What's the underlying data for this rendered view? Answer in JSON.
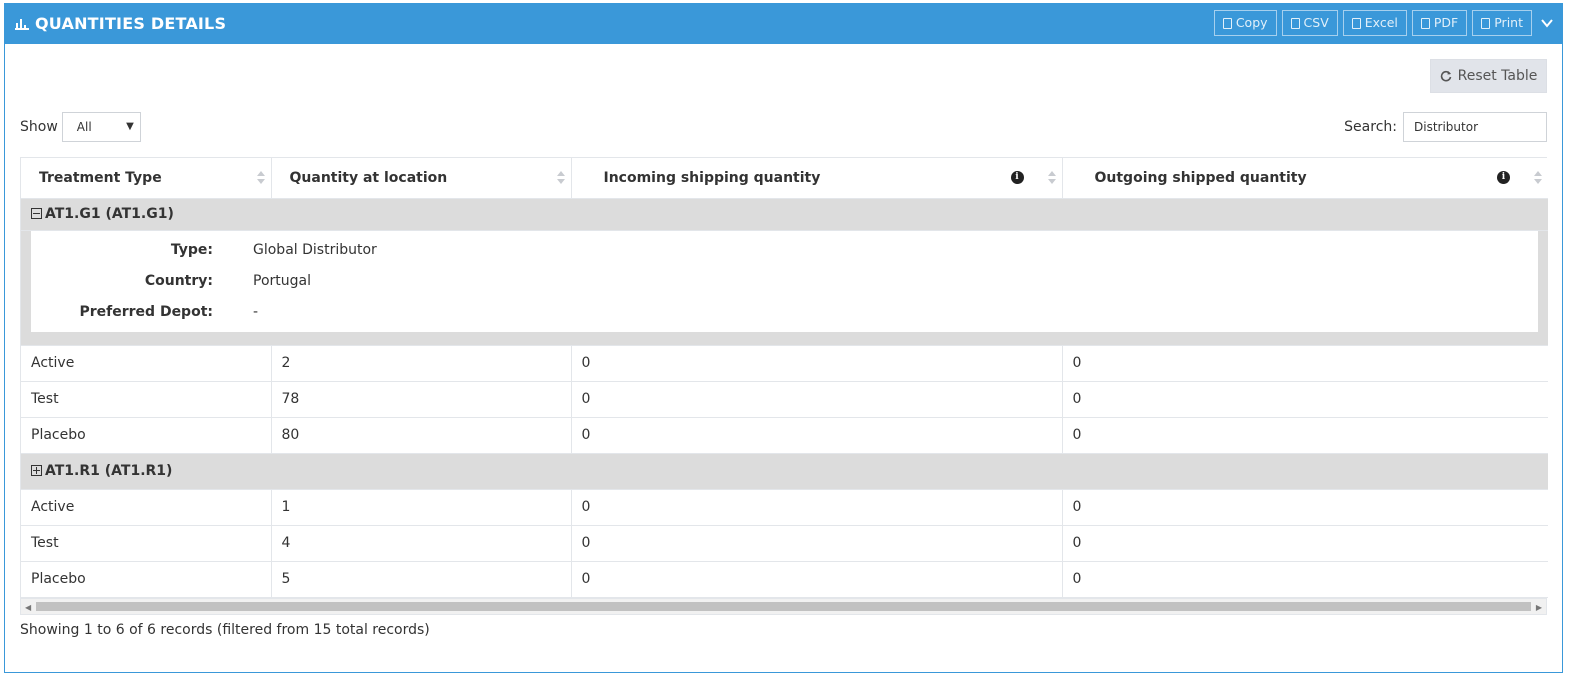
{
  "header": {
    "title": "QUANTITIES DETAILS",
    "buttons": [
      "Copy",
      "CSV",
      "Excel",
      "PDF",
      "Print"
    ]
  },
  "reset_button": "Reset Table",
  "show": {
    "label": "Show",
    "value": "All"
  },
  "search": {
    "label": "Search:",
    "value": "Distributor"
  },
  "columns": [
    "Treatment Type",
    "Quantity at location",
    "Incoming shipping quantity",
    "Outgoing shipped quantity"
  ],
  "groups": [
    {
      "name": "AT1.G1 (AT1.G1)",
      "expanded": true,
      "details": [
        {
          "label": "Type:",
          "value": "Global Distributor"
        },
        {
          "label": "Country:",
          "value": "Portugal"
        },
        {
          "label": "Preferred Depot:",
          "value": "-"
        }
      ],
      "rows": [
        [
          "Active",
          "2",
          "0",
          "0"
        ],
        [
          "Test",
          "78",
          "0",
          "0"
        ],
        [
          "Placebo",
          "80",
          "0",
          "0"
        ]
      ]
    },
    {
      "name": "AT1.R1 (AT1.R1)",
      "expanded": false,
      "rows": [
        [
          "Active",
          "1",
          "0",
          "0"
        ],
        [
          "Test",
          "4",
          "0",
          "0"
        ],
        [
          "Placebo",
          "5",
          "0",
          "0"
        ]
      ]
    }
  ],
  "footer": "Showing 1 to 6 of 6 records (filtered from 15 total records)",
  "colors": {
    "header_bg": "#3a98d9",
    "group_bg": "#dcdcdc"
  }
}
